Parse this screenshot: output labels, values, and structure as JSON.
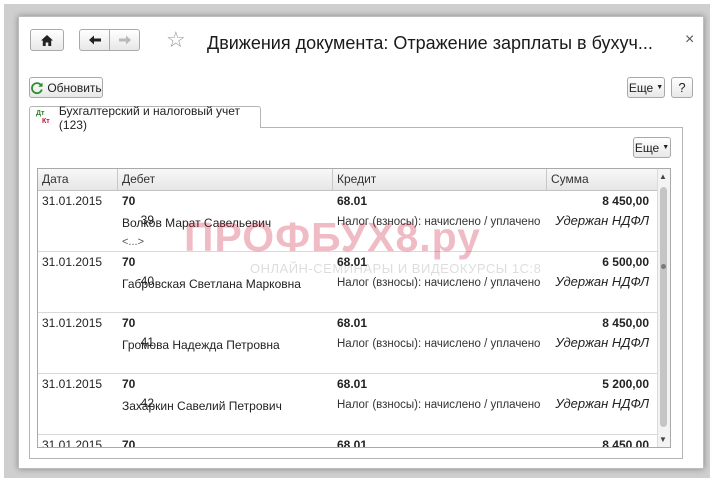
{
  "window": {
    "title": "Движения документа: Отражение зарплаты в бухуч...",
    "close_glyph": "×"
  },
  "toolbar": {
    "refresh_label": "Обновить",
    "more_label": "Еще",
    "help_label": "?"
  },
  "tab": {
    "icon_top": "Дт",
    "icon_bottom": "Кт",
    "label": "Бухгалтерский и налоговый учет (123)"
  },
  "grid": {
    "more_label": "Еще",
    "columns": [
      "Дата",
      "Дебет",
      "Кредит",
      "Сумма"
    ],
    "rows": [
      {
        "date": "31.01.2015",
        "num": "39",
        "debit": "70",
        "person": "Волков Марат Савельевич",
        "more": "<...>",
        "credit": "68.01",
        "desc": "Налог (взносы): начислено / уплачено",
        "amount": "8 450,00",
        "op": "Удержан НДФЛ"
      },
      {
        "date": "31.01.2015",
        "num": "40",
        "debit": "70",
        "person": "Габровская Светлана Марковна",
        "more": "",
        "credit": "68.01",
        "desc": "Налог (взносы): начислено / уплачено",
        "amount": "6 500,00",
        "op": "Удержан НДФЛ"
      },
      {
        "date": "31.01.2015",
        "num": "41",
        "debit": "70",
        "person": "Громова Надежда Петровна",
        "more": "",
        "credit": "68.01",
        "desc": "Налог (взносы): начислено / уплачено",
        "amount": "8 450,00",
        "op": "Удержан НДФЛ"
      },
      {
        "date": "31.01.2015",
        "num": "42",
        "debit": "70",
        "person": "Захаркин Савелий Петрович",
        "more": "",
        "credit": "68.01",
        "desc": "Налог (взносы): начислено / уплачено",
        "amount": "5 200,00",
        "op": "Удержан НДФЛ"
      },
      {
        "date": "31.01.2015",
        "num": "",
        "debit": "70",
        "person": "",
        "more": "",
        "credit": "68.01",
        "desc": "",
        "amount": "8 450,00",
        "op": ""
      }
    ]
  },
  "watermark": {
    "big": "ПРОФБУХ8.ру",
    "small": "ОНЛАЙН-СЕМИНАРЫ И ВИДЕОКУРСЫ 1С:8"
  },
  "colors": {
    "watermark": "#c8102e",
    "refresh_icon": "#2e8b2e"
  }
}
